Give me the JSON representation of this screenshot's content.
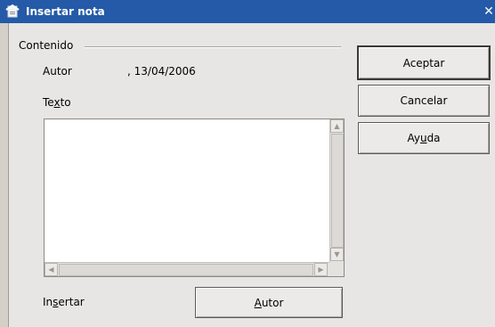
{
  "window": {
    "title": "Insertar nota",
    "app_icon": "document-note-icon",
    "close_icon": "close-icon",
    "title_color": "#245aa8"
  },
  "contenido": {
    "group_label": "Contenido",
    "autor_label": "Autor",
    "autor_value": ", 13/04/2006",
    "texto_label_pre": "Te",
    "texto_label_accel": "x",
    "texto_label_post": "to",
    "texto_value": ""
  },
  "insertar": {
    "label_pre": "In",
    "label_accel": "s",
    "label_post": "ertar",
    "autor_button_accel": "A",
    "autor_button_rest": "utor"
  },
  "buttons": {
    "aceptar": "Aceptar",
    "cancelar": "Cancelar",
    "ayuda_pre": "Ay",
    "ayuda_accel": "u",
    "ayuda_post": "da"
  }
}
